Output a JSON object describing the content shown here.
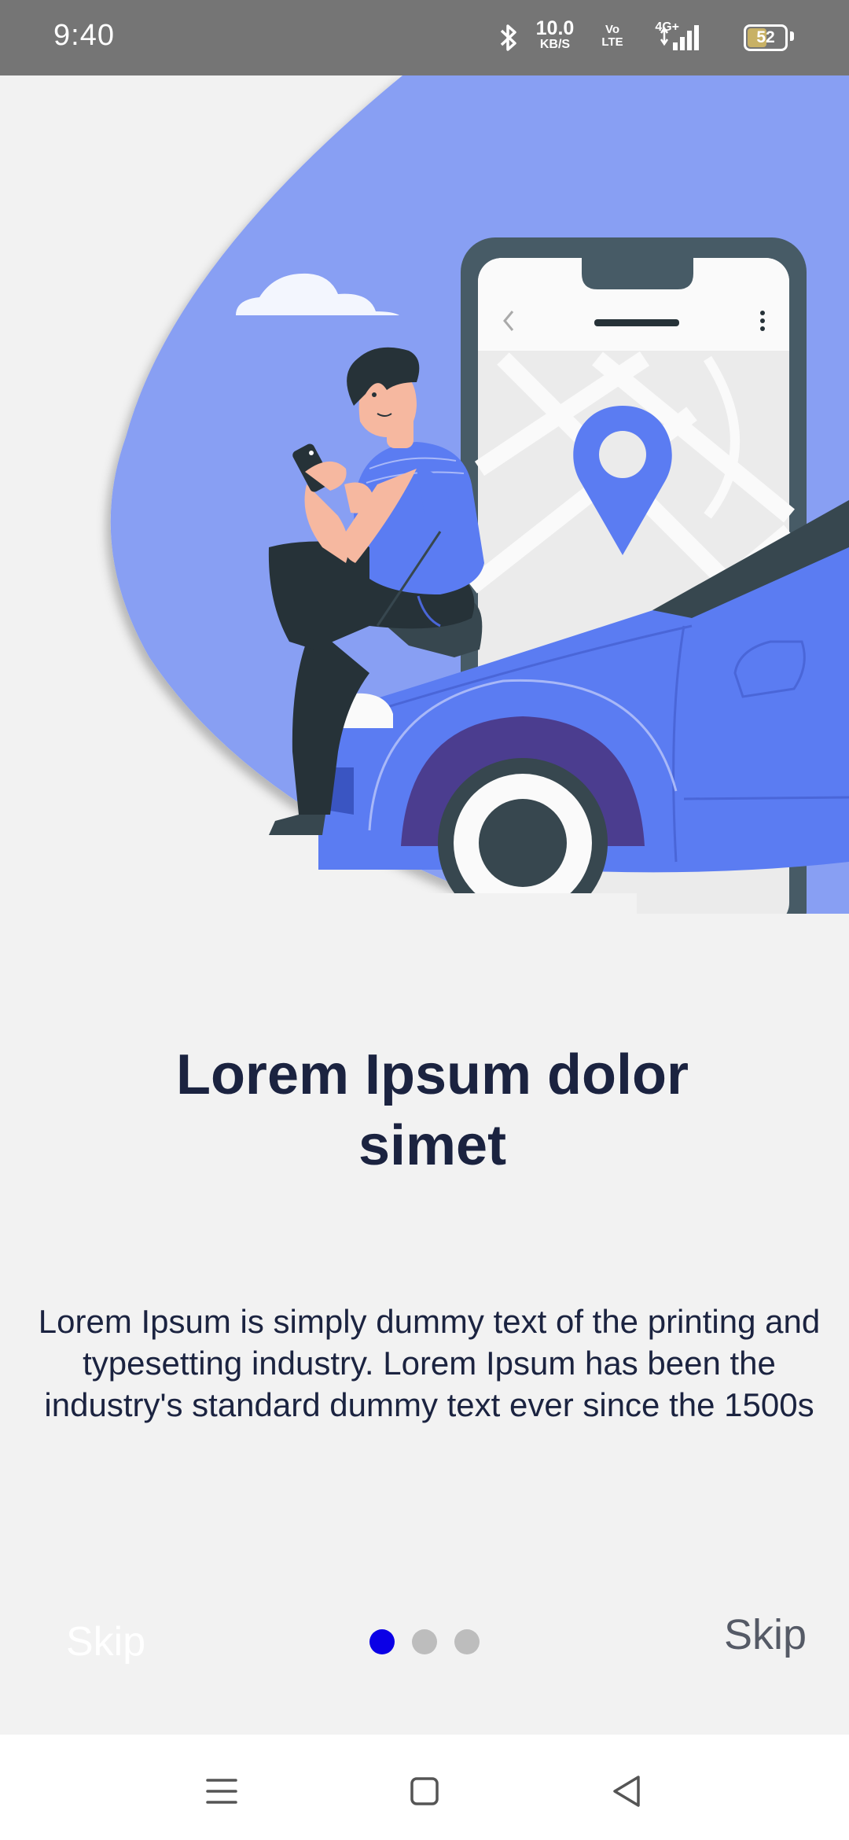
{
  "status_bar": {
    "time": "9:40",
    "net_speed_value": "10.0",
    "net_speed_unit": "KB/S",
    "volte_top": "Vo",
    "volte_bottom": "LTE",
    "network_type": "4G+",
    "battery_level": "52",
    "battery_fraction": 0.52,
    "icons": [
      "bluetooth-icon",
      "signal-icon",
      "battery-icon"
    ]
  },
  "illustration": {
    "name": "man-sitting-on-car-with-phone-map-illustration",
    "colors": {
      "accent": "#5b7cf2",
      "accent_light": "#889ff3",
      "dark": "#2b2f33",
      "map_bg": "#ebebeb"
    }
  },
  "onboarding": {
    "title_line1": "Lorem Ipsum dolor",
    "title_line2": "simet",
    "body": "Lorem Ipsum is simply dummy text of the printing and typesetting industry. Lorem Ipsum has been the industry's standard dummy text ever since the 1500s",
    "skip_left": "Skip",
    "skip_right": "Skip",
    "page_count": 3,
    "active_page": 1,
    "active_dot_color": "#0b00e6",
    "inactive_dot_color": "#bdbdbd"
  },
  "nav_bar": {
    "buttons": [
      "menu-icon",
      "home-icon",
      "back-icon"
    ]
  }
}
